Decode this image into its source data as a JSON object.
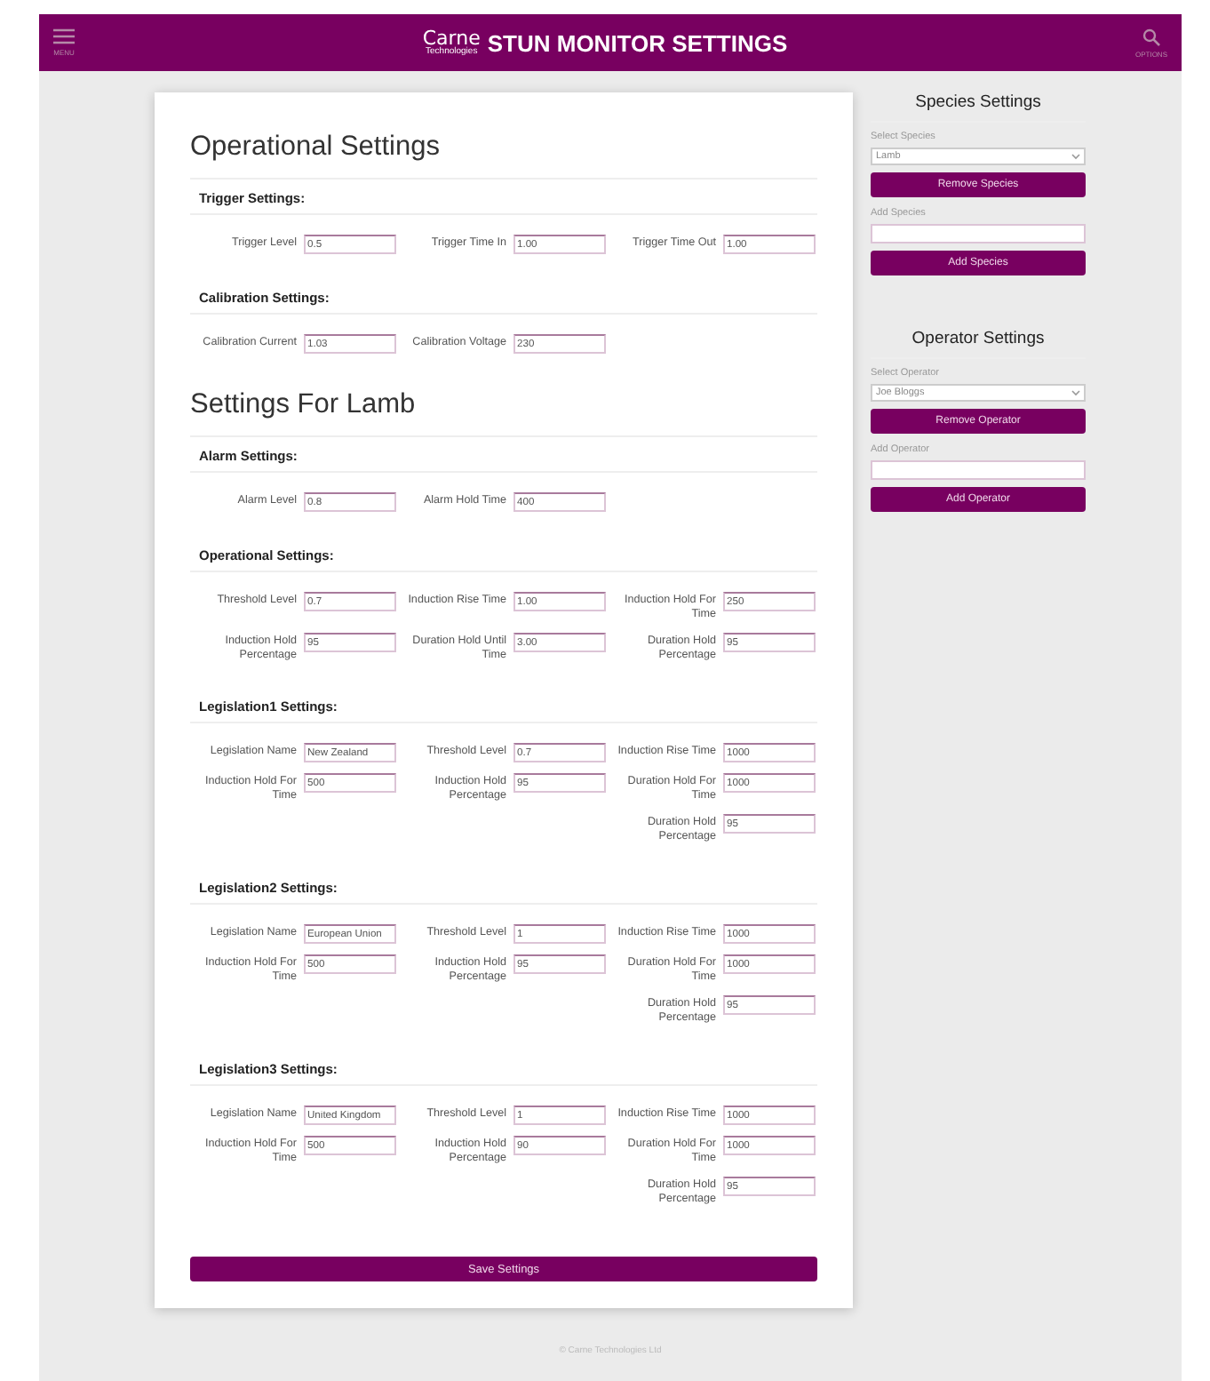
{
  "header": {
    "menu_label": "MENU",
    "logo_text": "Carne",
    "logo_subtext": "Technologies",
    "title": "STUN MONITOR SETTINGS",
    "options_label": "OPTIONS"
  },
  "main": {
    "sections": [
      {
        "title": "Operational Settings",
        "groups": [
          {
            "title": "Trigger Settings:",
            "rows": [
              [
                {
                  "kind": "field",
                  "label": "Trigger Level",
                  "value": "0.5"
                },
                {
                  "kind": "field",
                  "label": "Trigger Time In",
                  "value": "1.00"
                },
                {
                  "kind": "field",
                  "label": "Trigger Time Out",
                  "value": "1.00"
                }
              ]
            ]
          },
          {
            "title": "Calibration Settings:",
            "rows": [
              [
                {
                  "kind": "field",
                  "label": "Calibration Current",
                  "value": "1.03"
                },
                {
                  "kind": "field",
                  "label": "Calibration Voltage",
                  "value": "230"
                }
              ]
            ]
          }
        ]
      },
      {
        "title": "Settings For Lamb",
        "groups": [
          {
            "title": "Alarm Settings:",
            "rows": [
              [
                {
                  "kind": "field",
                  "label": "Alarm Level",
                  "value": "0.8"
                },
                {
                  "kind": "field",
                  "label": "Alarm Hold Time",
                  "value": "400"
                }
              ]
            ]
          },
          {
            "title": "Operational Settings:",
            "rows": [
              [
                {
                  "kind": "field",
                  "label": "Threshold Level",
                  "value": "0.7"
                },
                {
                  "kind": "field",
                  "label": "Induction Rise Time",
                  "value": "1.00"
                },
                {
                  "kind": "field",
                  "label": "Induction Hold For Time",
                  "value": "250"
                }
              ],
              [
                {
                  "kind": "field",
                  "label": "Induction Hold Percentage",
                  "value": "95"
                },
                {
                  "kind": "field",
                  "label": "Duration Hold Until Time",
                  "value": "3.00"
                },
                {
                  "kind": "field",
                  "label": "Duration Hold Percentage",
                  "value": "95"
                }
              ]
            ]
          },
          {
            "title": "Legislation1 Settings:",
            "rows": [
              [
                {
                  "kind": "field",
                  "label": "Legislation Name",
                  "value": "New Zealand"
                },
                {
                  "kind": "field",
                  "label": "Threshold Level",
                  "value": "0.7"
                },
                {
                  "kind": "field",
                  "label": "Induction Rise Time",
                  "value": "1000"
                }
              ],
              [
                {
                  "kind": "field",
                  "label": "Induction Hold For Time",
                  "value": "500"
                },
                {
                  "kind": "field",
                  "label": "Induction Hold Percentage",
                  "value": "95"
                },
                {
                  "kind": "field",
                  "label": "Duration Hold For Time",
                  "value": "1000"
                }
              ],
              [
                {
                  "kind": "empty"
                },
                {
                  "kind": "empty"
                },
                {
                  "kind": "field",
                  "label": "Duration Hold Percentage",
                  "value": "95"
                }
              ]
            ]
          },
          {
            "title": "Legislation2 Settings:",
            "rows": [
              [
                {
                  "kind": "field",
                  "label": "Legislation Name",
                  "value": "European Union"
                },
                {
                  "kind": "field",
                  "label": "Threshold Level",
                  "value": "1"
                },
                {
                  "kind": "field",
                  "label": "Induction Rise Time",
                  "value": "1000"
                }
              ],
              [
                {
                  "kind": "field",
                  "label": "Induction Hold For Time",
                  "value": "500"
                },
                {
                  "kind": "field",
                  "label": "Induction Hold Percentage",
                  "value": "95"
                },
                {
                  "kind": "field",
                  "label": "Duration Hold For Time",
                  "value": "1000"
                }
              ],
              [
                {
                  "kind": "empty"
                },
                {
                  "kind": "empty"
                },
                {
                  "kind": "field",
                  "label": "Duration Hold Percentage",
                  "value": "95"
                }
              ]
            ]
          },
          {
            "title": "Legislation3 Settings:",
            "rows": [
              [
                {
                  "kind": "field",
                  "label": "Legislation Name",
                  "value": "United Kingdom"
                },
                {
                  "kind": "field",
                  "label": "Threshold Level",
                  "value": "1"
                },
                {
                  "kind": "field",
                  "label": "Induction Rise Time",
                  "value": "1000"
                }
              ],
              [
                {
                  "kind": "field",
                  "label": "Induction Hold For Time",
                  "value": "500"
                },
                {
                  "kind": "field",
                  "label": "Induction Hold Percentage",
                  "value": "90"
                },
                {
                  "kind": "field",
                  "label": "Duration Hold For Time",
                  "value": "1000"
                }
              ],
              [
                {
                  "kind": "empty"
                },
                {
                  "kind": "empty"
                },
                {
                  "kind": "field",
                  "label": "Duration Hold Percentage",
                  "value": "95"
                }
              ]
            ]
          }
        ]
      }
    ],
    "save_button": "Save Settings"
  },
  "sidebar": [
    {
      "title": "Species Settings",
      "select_label": "Select Species",
      "select_value": "Lamb",
      "remove_button": "Remove Species",
      "add_label": "Add Species",
      "add_button": "Add Species"
    },
    {
      "title": "Operator Settings",
      "select_label": "Select Operator",
      "select_value": "Joe Bloggs",
      "remove_button": "Remove Operator",
      "add_label": "Add Operator",
      "add_button": "Add Operator"
    }
  ],
  "footer": "© Carne Technologies Ltd"
}
